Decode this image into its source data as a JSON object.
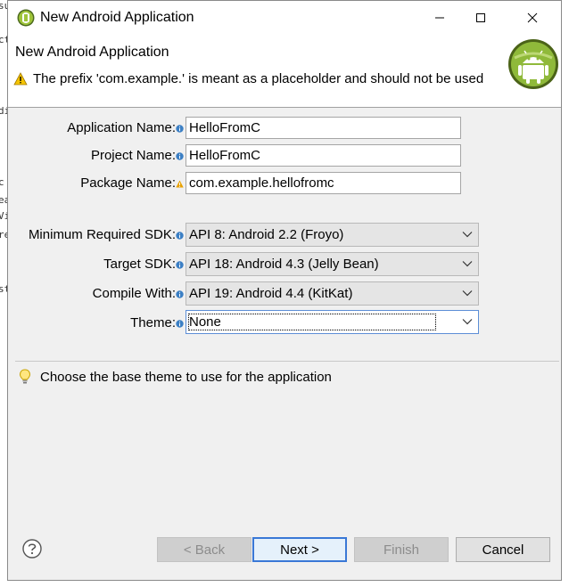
{
  "window": {
    "title": "New Android Application"
  },
  "header": {
    "page_title": "New Android Application",
    "warning": "The prefix 'com.example.' is meant as a placeholder and should not be used"
  },
  "form": {
    "application_name_label": "Application Name:",
    "application_name_value": "HelloFromC",
    "project_name_label": "Project Name:",
    "project_name_value": "HelloFromC",
    "package_name_label": "Package Name:",
    "package_name_value": "com.example.hellofromc",
    "min_sdk_label": "Minimum Required SDK:",
    "min_sdk_value": "API 8: Android 2.2 (Froyo)",
    "target_sdk_label": "Target SDK:",
    "target_sdk_value": "API 18: Android 4.3 (Jelly Bean)",
    "compile_with_label": "Compile With:",
    "compile_with_value": "API 19: Android 4.4 (KitKat)",
    "theme_label": "Theme:",
    "theme_value": "None"
  },
  "hint": "Choose the base theme to use for the application",
  "buttons": {
    "back": "< Back",
    "next": "Next >",
    "finish": "Finish",
    "cancel": "Cancel"
  },
  "background_editor_fragments": [
    "su",
    "ct",
    "di",
    "c",
    "ea",
    "Vi",
    "re",
    "st"
  ],
  "colors": {
    "window_bg": "#f0f0f0",
    "focus_border": "#3a78d6",
    "info_deco": "#3b7fc4",
    "warn_deco": "#e8a100"
  },
  "icons": {
    "title": "android-eclipse-icon",
    "header_image": "android-robot-icon",
    "warning": "warning-icon",
    "hint": "lightbulb-icon",
    "help": "help-icon"
  }
}
